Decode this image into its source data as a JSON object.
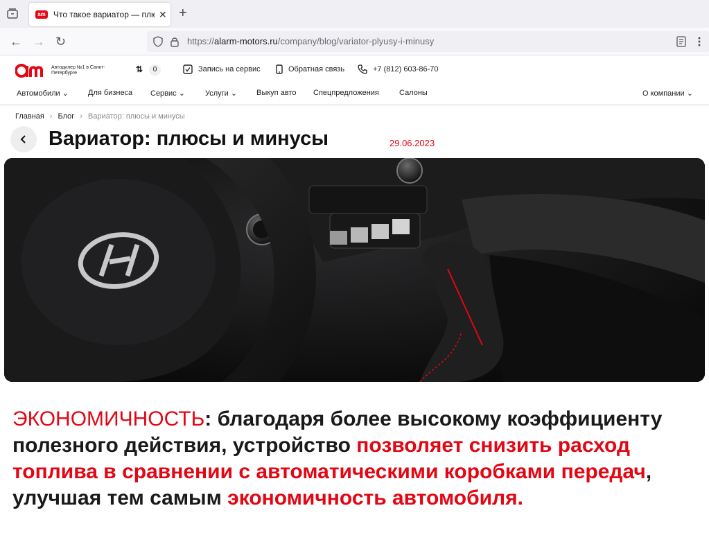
{
  "browser": {
    "tab_title": "Что такое вариатор — плюсы",
    "tab_favicon_text": "am",
    "url_domain": "alarm-motors.ru",
    "url_prefix": "https://",
    "url_path": "/company/blog/variator-plyusy-i-minusy"
  },
  "header": {
    "tagline": "Автодилер №1 в Санкт-Петербурге",
    "compare_count": "0",
    "service_label": "Запись на сервис",
    "callback_label": "Обратная связь",
    "phone": "+7 (812) 603-86-70"
  },
  "nav": {
    "items": [
      {
        "label": "Автомобили ⌄"
      },
      {
        "label": "Для бизнеса"
      },
      {
        "label": "Сервис ⌄"
      },
      {
        "label": "Услуги ⌄"
      },
      {
        "label": "Выкуп авто"
      },
      {
        "label": "Спецпредложения"
      },
      {
        "label": "Салоны"
      },
      {
        "label": "О компании ⌄"
      }
    ]
  },
  "breadcrumb": {
    "home": "Главная",
    "blog": "Блог",
    "current": "Вариатор: плюсы и минусы"
  },
  "article": {
    "title": "Вариатор: плюсы и минусы",
    "date": "29.06.2023",
    "text_part1": "ЭКОНОМИЧНОСТЬ",
    "text_part2": ": благодаря более высокому коэффициенту полезного действия, устройство ",
    "text_part3": "позволяет снизить расход топлива в сравнении с автоматическими коробками передач",
    "text_part4": ", улучшая тем самым ",
    "text_part5": "экономичность автомобиля."
  },
  "colors": {
    "accent": "#e30613",
    "text": "#1a1a1a",
    "chrome_bg": "#f0f0f4"
  }
}
